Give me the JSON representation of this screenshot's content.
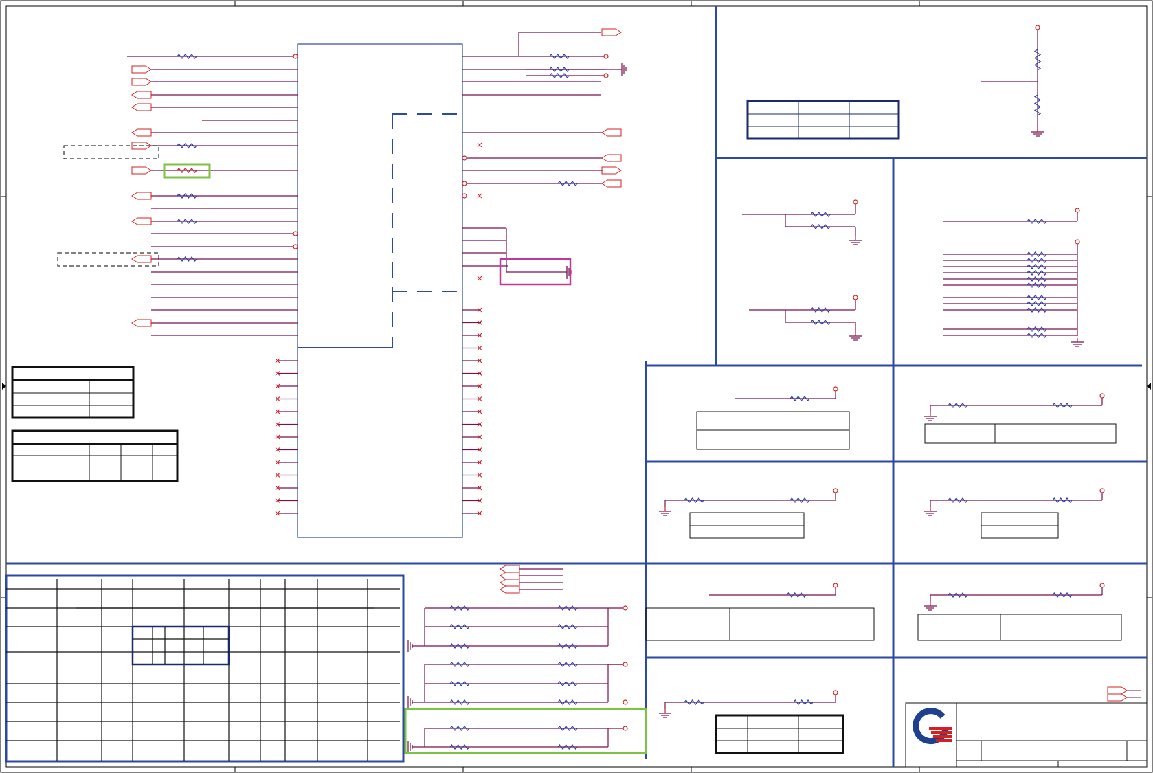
{
  "sheet": {
    "border_color": "#000000",
    "frame_color": "#2b4aa0",
    "wire_color": "#d42020",
    "net_color": "#7a1050",
    "resistor_color": "#2840b0",
    "highlight_green": "#7cc243",
    "highlight_magenta": "#c0399a",
    "title_block": {
      "logo_icon": "company-logo-icon",
      "logo_blue": "#1f3f8f",
      "logo_red": "#d42020"
    }
  }
}
